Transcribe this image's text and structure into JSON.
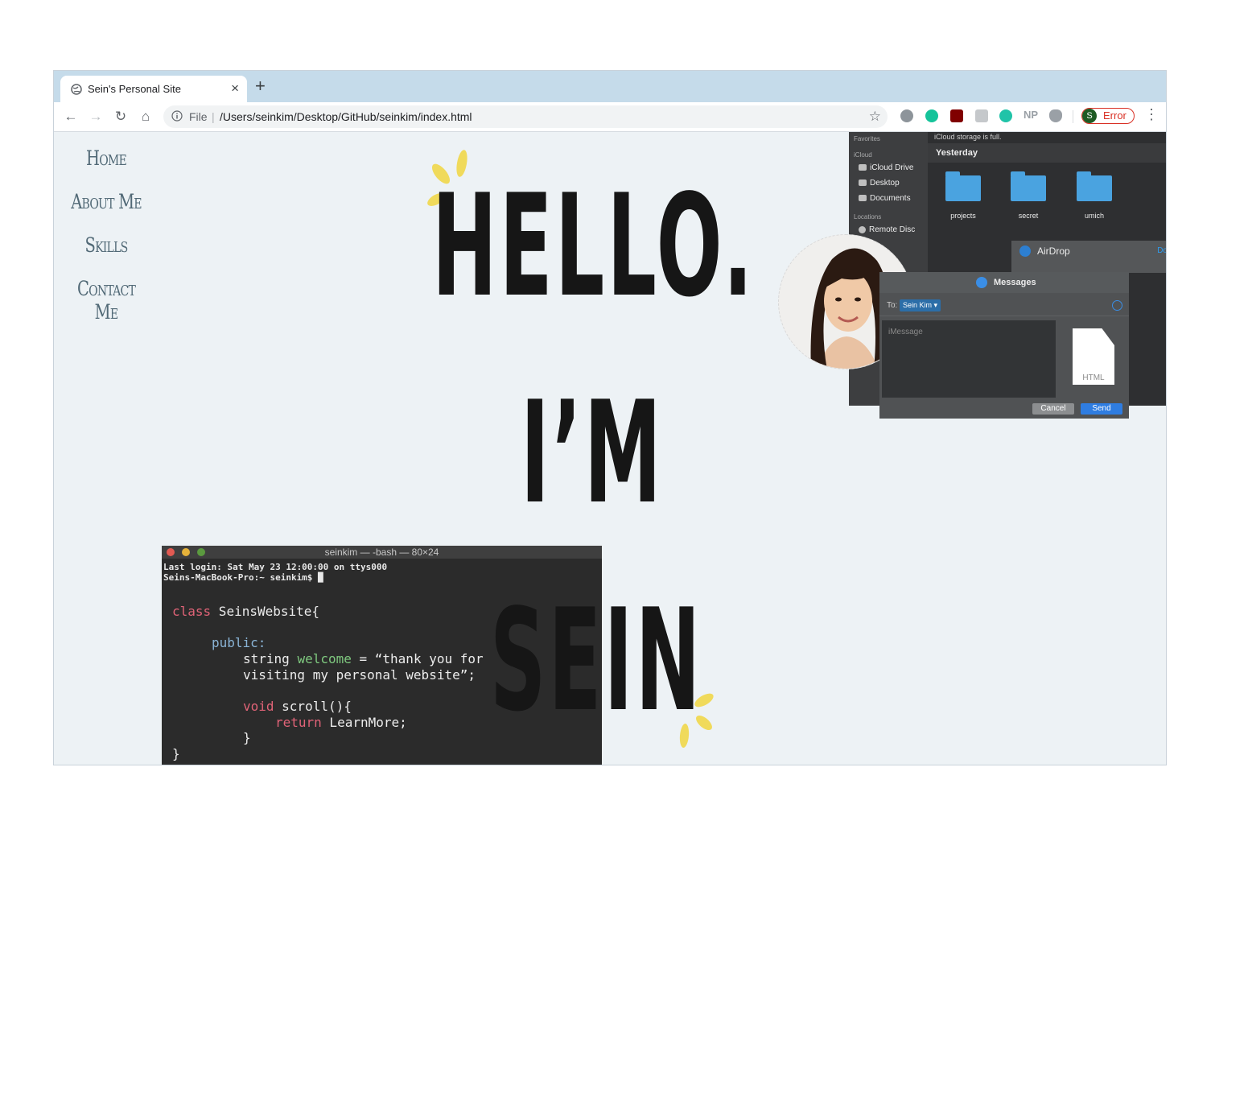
{
  "browser": {
    "tab_title": "Sein's Personal Site",
    "tab_close": "×",
    "new_tab": "+",
    "nav": {
      "back": "←",
      "forward": "→",
      "reload": "↻",
      "home": "⌂"
    },
    "omnibox": {
      "scheme": "File",
      "separator": "|",
      "url": "/Users/seinkim/Desktop/GitHub/seinkim/index.html"
    },
    "star": "☆",
    "extensions": {
      "np_label": "NP"
    },
    "profile": {
      "initial": "S",
      "label": "Error"
    },
    "menu": "⋮",
    "colors": {
      "tabbar": "#c5dbea",
      "error": "#d93025"
    }
  },
  "sidebar": {
    "items": [
      {
        "label": "Home"
      },
      {
        "label": "About Me"
      },
      {
        "label": "Skills"
      },
      {
        "label": "Contact Me"
      }
    ]
  },
  "hero": {
    "line1": "HELLO.",
    "line2": "I’M",
    "line3": "SEIN"
  },
  "terminal": {
    "title": "seinkim — -bash — 80×24",
    "login_line": "Last login: Sat May 23 12:00:00 on ttys000",
    "prompt_line": "Seins-MacBook-Pro:~ seinkim$ █",
    "code": {
      "class_kw": "class",
      "class_name": " SeinsWebsite{",
      "public_kw": "public:",
      "string_type": "string ",
      "welcome_var": "welcome",
      "assign": " = “thank you for",
      "assign_cont": "visiting my personal website”;",
      "void_kw": "void",
      "scroll_fn": " scroll(){",
      "return_kw": "return",
      "return_val": " LearnMore;",
      "inner_close": "}",
      "outer_close": "}"
    }
  },
  "finder": {
    "sidebar": {
      "favorites": "Favorites",
      "icloud": "iCloud",
      "icloud_drive": "iCloud Drive",
      "desktop": "Desktop",
      "documents": "Documents",
      "locations": "Locations",
      "remote_disc": "Remote Disc"
    },
    "notice": "iCloud storage is full.",
    "section": "Yesterday",
    "folders": [
      {
        "label": "projects"
      },
      {
        "label": "secret"
      },
      {
        "label": "umich"
      }
    ],
    "airdrop": {
      "label": "AirDrop",
      "action": "Do"
    }
  },
  "messages": {
    "title": "Messages",
    "to_label": "To:",
    "recipient": "Sein Kim ▾",
    "placeholder": "iMessage",
    "attachment": "HTML",
    "cancel": "Cancel",
    "send": "Send"
  }
}
